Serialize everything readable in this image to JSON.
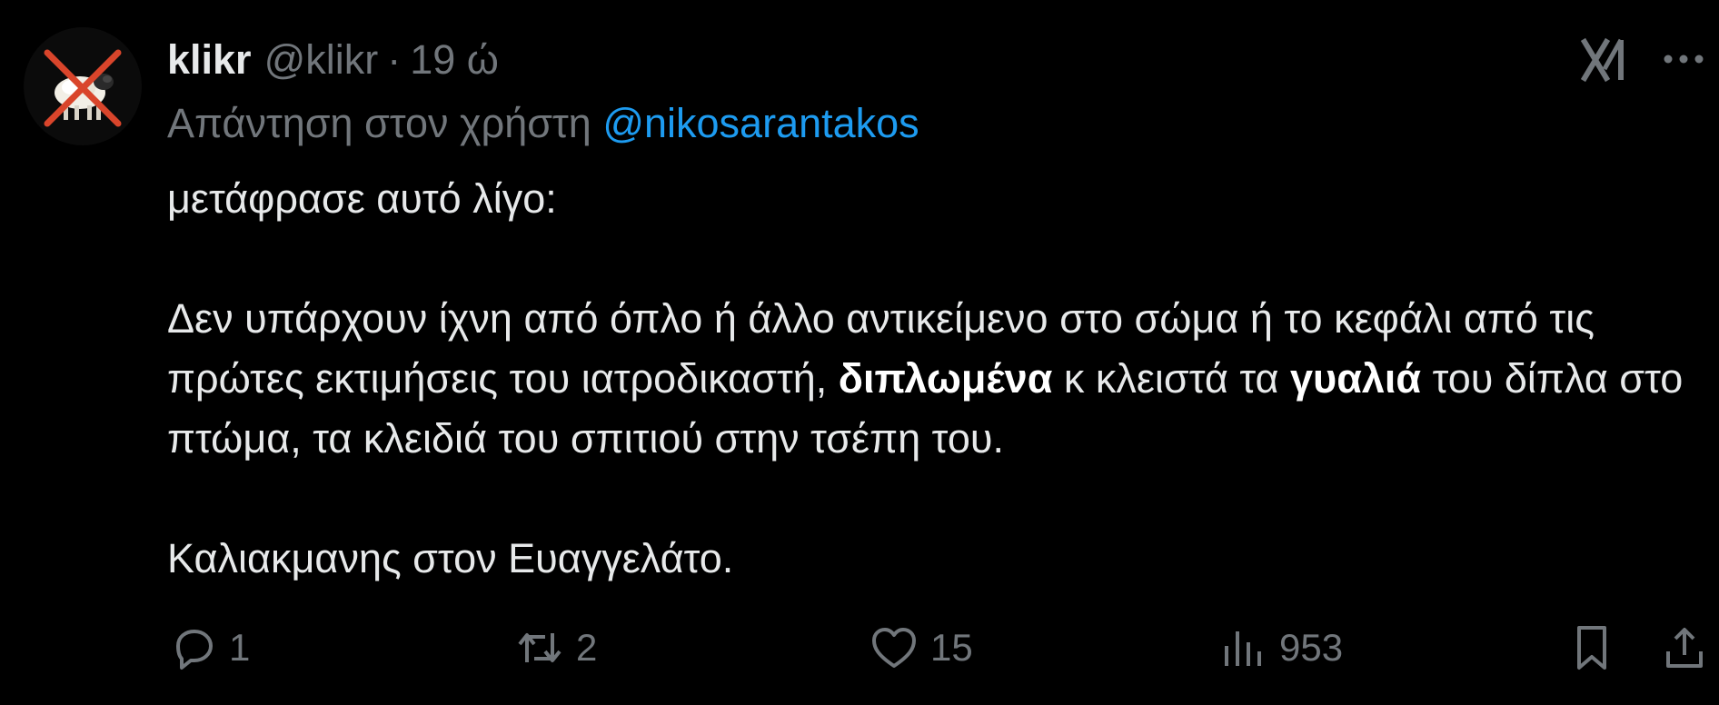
{
  "tweet": {
    "author": {
      "display_name": "klikr",
      "handle": "@klikr",
      "separator": "·",
      "time": "19 ώ"
    },
    "reply_to": {
      "prefix": "Απάντηση στον χρήστη",
      "mention": "@nikosarantakos"
    },
    "body": {
      "line1": "μετάφρασε αυτό λίγο:",
      "para2_a": "Δεν υπάρχουν ίχνη από όπλο ή άλλο αντικείμενο στο σώμα ή το κεφάλι από τις πρώτες εκτιμήσεις του ιατροδικαστή, ",
      "para2_bold1": "διπλωμένα",
      "para2_b": " κ κλειστά τα ",
      "para2_bold2": "γυαλιά",
      "para2_c": " του δίπλα στο πτώμα, τα κλειδιά του σπιτιού στην τσέπη του.",
      "para3": "Καλιακμανης στον Ευαγγελάτο."
    },
    "actions": {
      "replies": "1",
      "retweets": "2",
      "likes": "15",
      "views": "953"
    }
  },
  "colors": {
    "background": "#000000",
    "text": "#e7e9ea",
    "muted": "#71767b",
    "link": "#1d9bf0"
  },
  "icons": [
    "grok-icon",
    "more-icon",
    "reply-icon",
    "retweet-icon",
    "like-icon",
    "views-icon",
    "bookmark-icon",
    "share-icon"
  ]
}
